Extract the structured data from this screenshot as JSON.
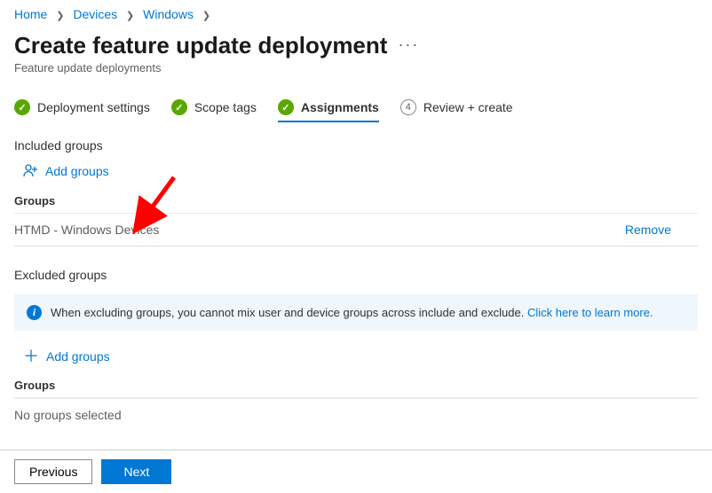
{
  "breadcrumb": {
    "home": "Home",
    "devices": "Devices",
    "windows": "Windows"
  },
  "header": {
    "title": "Create feature update deployment",
    "subtitle": "Feature update deployments"
  },
  "tabs": {
    "deployment": "Deployment settings",
    "scope": "Scope tags",
    "assignments": "Assignments",
    "review_num": "4",
    "review": "Review + create"
  },
  "included": {
    "label": "Included groups",
    "add": "Add groups",
    "groups_header": "Groups",
    "row_name": "HTMD - Windows Devices",
    "row_action": "Remove"
  },
  "excluded": {
    "label": "Excluded groups",
    "info_text": "When excluding groups, you cannot mix user and device groups across include and exclude.",
    "info_link": "Click here to learn more.",
    "add": "Add groups",
    "groups_header": "Groups",
    "empty": "No groups selected"
  },
  "footer": {
    "prev": "Previous",
    "next": "Next"
  }
}
